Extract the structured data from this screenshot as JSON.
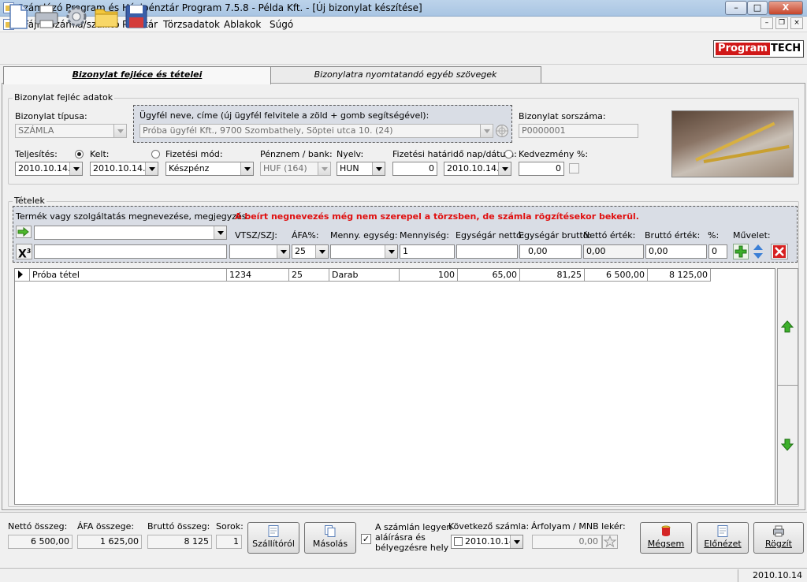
{
  "window": {
    "title": "Számlázó Program és Házipénztár Program 7.5.8 - Példa Kft. - [Új bizonylat készítése]",
    "min": "–",
    "max": "□",
    "close": "X"
  },
  "menu": [
    "Fájl",
    "Számla/szállító",
    "Pénztár",
    "Törzsadatok",
    "Ablakok",
    "Súgó"
  ],
  "mdi_buttons": [
    "–",
    "❐",
    "×"
  ],
  "logo": {
    "program": "Program",
    "tech": "TECH"
  },
  "tabs": [
    "Bizonylat fejléce és tételei",
    "Bizonylatra nyomtatandó egyéb szövegek"
  ],
  "header_group": {
    "title": "Bizonylat fejléc adatok",
    "type_label": "Bizonylat típusa:",
    "type_value": "SZÁMLA",
    "customer_label": "Ügyfél neve, címe (új ügyfél felvitele a zöld + gomb segítségével):",
    "customer_value": "Próba ügyfél Kft., 9700 Szombathely, Söptei utca 10. (24)",
    "serial_label": "Bizonylat sorszáma:",
    "serial_value": "P0000001",
    "fulfilment_label": "Teljesítés:",
    "fulfilment_date": "2010.10.14.",
    "issue_label": "Kelt:",
    "issue_date": "2010.10.14.",
    "payment_label": "Fizetési mód:",
    "payment_value": "Készpénz",
    "currency_label": "Pénznem / bank:",
    "currency_value": "HUF  (164)",
    "language_label": "Nyelv:",
    "language_value": "HUN",
    "deadline_label": "Fizetési határidő nap/dátum:",
    "deadline_days": "0",
    "deadline_date": "2010.10.14.",
    "discount_label": "Kedvezmény %:",
    "discount_value": "0"
  },
  "items_group": {
    "title": "Tételek",
    "product_label": "Termék vagy szolgáltatás megnevezése, megjegyzés:",
    "warning": "A beírt negnevezés még nem szerepel a törzsben, de számla rögzítésekor bekerül.",
    "cols": {
      "vtsz": "VTSZ/SZJ:",
      "afa": "ÁFA%:",
      "unit": "Menny. egység:",
      "qty": "Mennyiség:",
      "net_unit": "Egységár nettó:",
      "gross_unit": "Egységár bruttó:",
      "net_value": "Nettó érték:",
      "gross_value": "Bruttó érték:",
      "pct": "%:",
      "action": "Művelet:"
    },
    "superscript_x": "X",
    "superscript_n": "3",
    "entry": {
      "afa": "25",
      "qty": "1",
      "gross_unit": "0,00",
      "net_value": "0,00",
      "gross_value": "0,00",
      "pct": "0"
    },
    "rows": [
      {
        "name": "Próba tétel",
        "vtsz": "1234",
        "afa": "25",
        "unit": "Darab",
        "qty": "100",
        "net_unit": "65,00",
        "gross_unit": "81,25",
        "net_value": "6 500,00",
        "gross_value": "8 125,00"
      }
    ]
  },
  "footer": {
    "net_label": "Nettó összeg:",
    "net_value": "6 500,00",
    "vat_label": "ÁFA összege:",
    "vat_value": "1 625,00",
    "gross_label": "Bruttó összeg:",
    "gross_value": "8 125",
    "rows_label": "Sorok:",
    "rows_value": "1",
    "btn_delivery": "Szállítóról",
    "btn_copy": "Másolás",
    "sign_line1": "A számlán legyen",
    "sign_line2": "aláírásra és",
    "sign_line3": "bélyegzésre hely",
    "next_invoice_label": "Következő számla:",
    "next_invoice_date": "2010.10.14.",
    "rate_label": "Árfolyam / MNB lekér:",
    "rate_value": "0,00",
    "btn_cancel": "Mégsem",
    "btn_preview": "Előnézet",
    "btn_save": "Rögzít"
  },
  "status_date": "2010.10.14"
}
